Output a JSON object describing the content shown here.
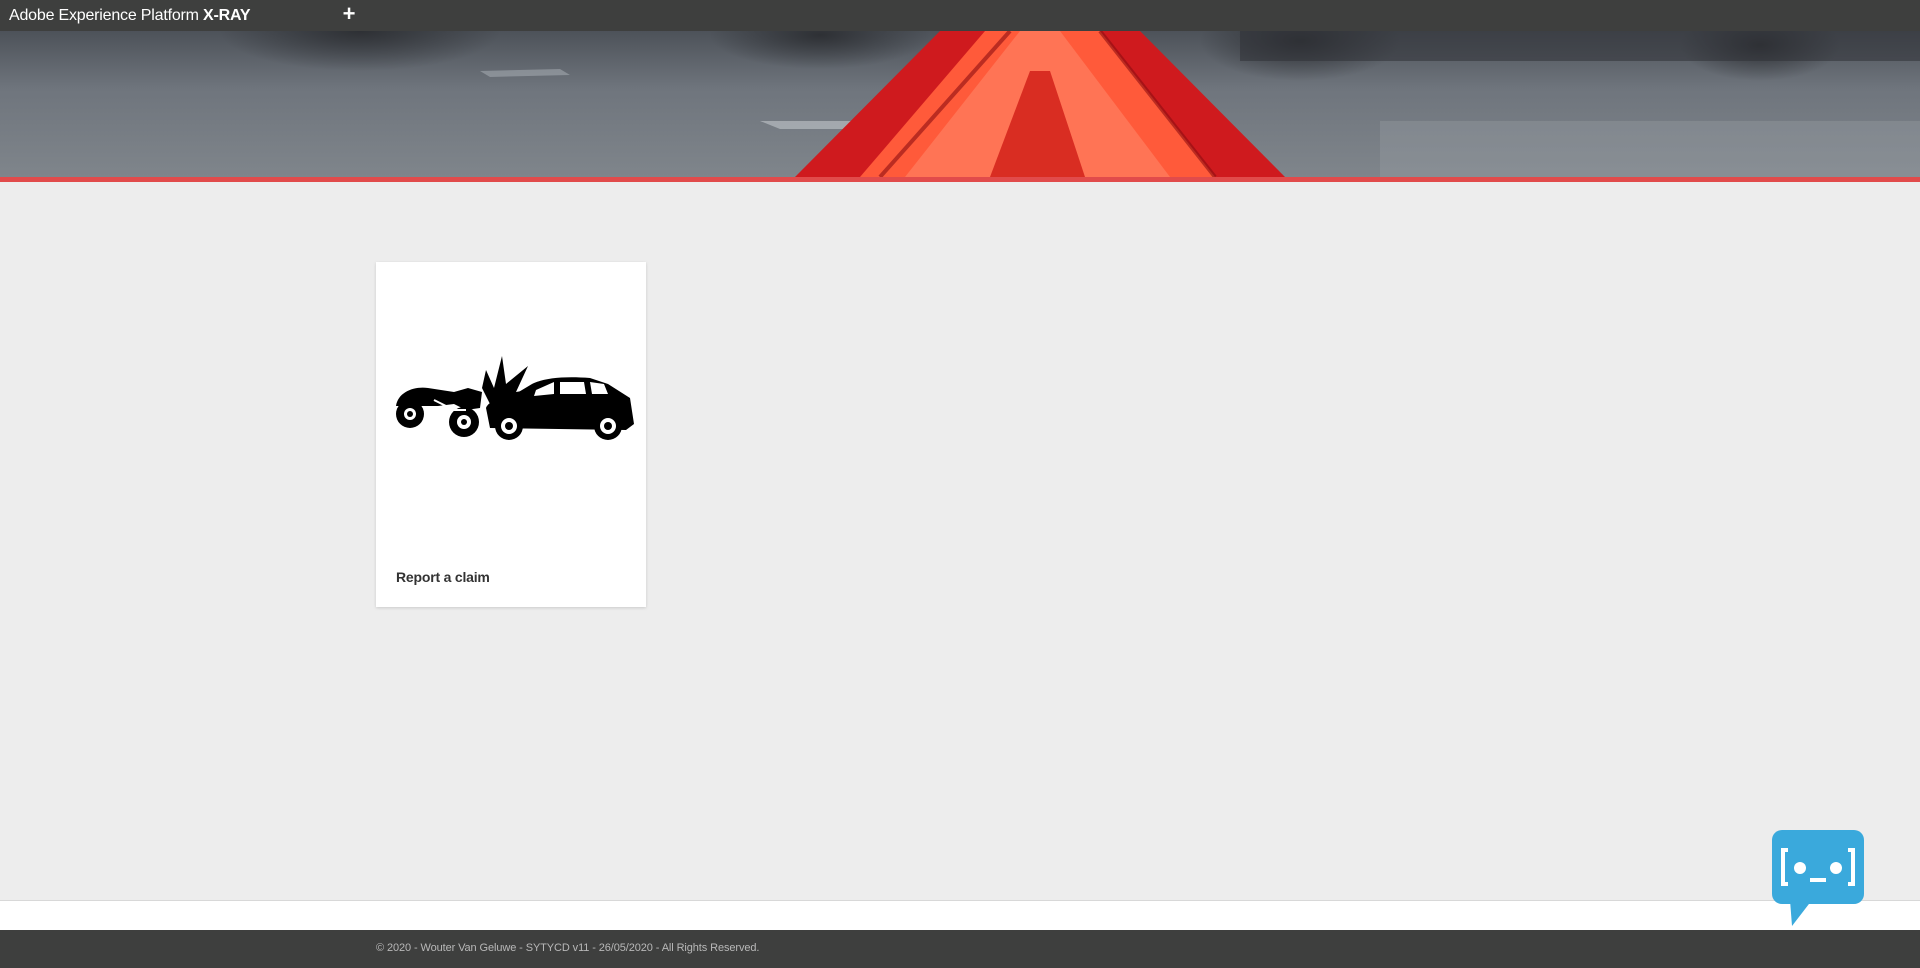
{
  "app": {
    "title_prefix": "Adobe Experience Platform",
    "title_strong": "X-RAY",
    "add_tab_label": "+"
  },
  "colors": {
    "topbar": "#3e3f3e",
    "accent_line": "#e14b4b",
    "page_background": "#ededed",
    "chatbot_blue": "#3aa9dc"
  },
  "hero": {
    "icon": "warning-triangle-photo"
  },
  "cards": [
    {
      "title": "Report a claim",
      "icon": "car-crash-icon"
    }
  ],
  "footer": {
    "copyright": "© 2020 - Wouter Van Geluwe - SYTYCD v11 - 26/05/2020 - All Rights Reserved."
  },
  "chatbot": {
    "icon": "chatbot-icon"
  }
}
